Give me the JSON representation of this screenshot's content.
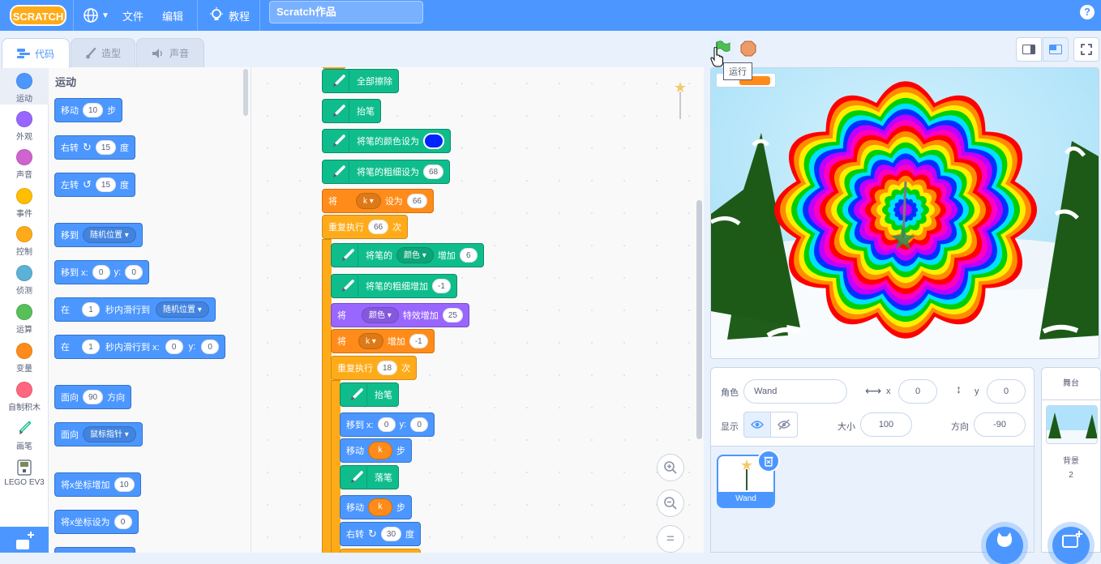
{
  "menubar": {
    "logo_text": "SCRATCH",
    "file_label": "文件",
    "edit_label": "编辑",
    "tutorials_label": "教程",
    "project_title": "Scratch作品",
    "help_symbol": "?"
  },
  "tabs": [
    {
      "label": "代码",
      "active": true
    },
    {
      "label": "造型",
      "active": false
    },
    {
      "label": "声音",
      "active": false
    }
  ],
  "categories": [
    {
      "label": "运动",
      "color": "#4c97ff"
    },
    {
      "label": "外观",
      "color": "#9966ff"
    },
    {
      "label": "声音",
      "color": "#cf63cf"
    },
    {
      "label": "事件",
      "color": "#ffbf00"
    },
    {
      "label": "控制",
      "color": "#ffab19"
    },
    {
      "label": "侦测",
      "color": "#5cb1d6"
    },
    {
      "label": "运算",
      "color": "#59c059"
    },
    {
      "label": "变量",
      "color": "#ff8c1a"
    },
    {
      "label": "自制积木",
      "color": "#ff6680"
    },
    {
      "label": "画笔",
      "color": "#0fbd8c"
    },
    {
      "label": "LEGO EV3",
      "color": "#575e75"
    }
  ],
  "palette": {
    "section_title": "运动",
    "move": {
      "text": "移动",
      "steps": "10",
      "unit": "步"
    },
    "turn_right": {
      "text": "右转",
      "deg": "15",
      "unit": "度"
    },
    "turn_left": {
      "text": "左转",
      "deg": "15",
      "unit": "度"
    },
    "goto": {
      "text": "移到",
      "target": "随机位置"
    },
    "goto_xy": {
      "text": "移到 x:",
      "x": "0",
      "ylabel": "y:",
      "y": "0"
    },
    "glide": {
      "pre": "在",
      "secs": "1",
      "text": "秒内滑行到",
      "target": "随机位置"
    },
    "glide_xy": {
      "pre": "在",
      "secs": "1",
      "text": "秒内滑行到 x:",
      "x": "0",
      "ylabel": "y:",
      "y": "0"
    },
    "point_dir": {
      "text": "面向",
      "deg": "90",
      "unit": "方向"
    },
    "point_towards": {
      "text": "面向",
      "target": "鼠标指针"
    },
    "change_x": {
      "text": "将x坐标增加",
      "value": "10"
    },
    "set_x": {
      "text": "将x坐标设为",
      "value": "0"
    }
  },
  "script": {
    "clear": "全部擦除",
    "pen_up1": "抬笔",
    "set_pen_color": "将笔的颜色设为",
    "set_pen_size": {
      "text": "将笔的粗细设为",
      "value": "68"
    },
    "set_var": {
      "pre": "将",
      "var": "k",
      "mid": "设为",
      "value": "66"
    },
    "repeat1": {
      "pre": "重复执行",
      "times": "66",
      "post": "次"
    },
    "change_pen_param": {
      "pre": "将笔的",
      "param": "颜色",
      "mid": "增加",
      "value": "6"
    },
    "change_pen_size": {
      "text": "将笔的粗细增加",
      "value": "-1"
    },
    "change_effect": {
      "pre": "将",
      "effect": "颜色",
      "mid": "特效增加",
      "value": "25"
    },
    "change_var": {
      "pre": "将",
      "var": "k",
      "mid": "增加",
      "value": "-1"
    },
    "repeat2": {
      "pre": "重复执行",
      "times": "18",
      "post": "次"
    },
    "pen_up2": "抬笔",
    "goto_xy": {
      "text": "移到 x:",
      "x": "0",
      "ylabel": "y:",
      "y": "0"
    },
    "move1": {
      "text": "移动",
      "var": "k",
      "unit": "步"
    },
    "pen_down": "落笔",
    "move2": {
      "text": "移动",
      "var": "k",
      "unit": "步"
    },
    "turn": {
      "text": "右转",
      "deg": "30",
      "unit": "度"
    }
  },
  "zoom": {
    "in": "+",
    "out": "−",
    "reset": "="
  },
  "stage_controls": {
    "tooltip": "运行"
  },
  "sprite_info": {
    "sprite_label": "角色",
    "sprite_name": "Wand",
    "x_label": "x",
    "x_value": "0",
    "y_label": "y",
    "y_value": "0",
    "show_label": "显示",
    "size_label": "大小",
    "size_value": "100",
    "direction_label": "方向",
    "direction_value": "-90"
  },
  "sprite_list": [
    {
      "name": "Wand",
      "selected": true
    }
  ],
  "stage_panel": {
    "title": "舞台",
    "backdrops_label": "背景",
    "backdrops_count": "2"
  },
  "colors": {
    "menubar": "#4c97ff",
    "motion": "#4c97ff",
    "looks": "#9966ff",
    "control": "#ffab19",
    "variables": "#ff8c1a",
    "pen": "#0fbd8c",
    "pen_color_swatch": "#0022ff"
  }
}
